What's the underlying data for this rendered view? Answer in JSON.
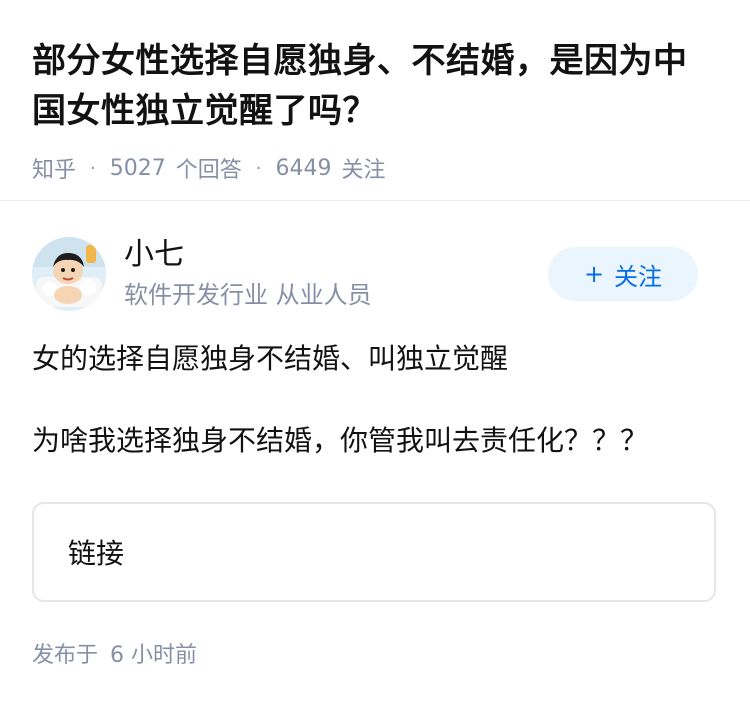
{
  "question": {
    "title": "部分女性选择自愿独身、不结婚，是因为中国女性独立觉醒了吗？",
    "source": "知乎",
    "answer_count": "5027",
    "answer_label": "个回答",
    "follow_count": "6449",
    "follow_label": "关注"
  },
  "author": {
    "name": "小七",
    "description": "软件开发行业 从业人员",
    "follow_button_label": "关注",
    "follow_button_icon": "plus-icon"
  },
  "answer": {
    "paragraphs": [
      "女的选择自愿独身不结婚、叫独立觉醒",
      "为啥我选择独身不结婚，你管我叫去责任化？？？"
    ],
    "link_label": "链接"
  },
  "footer": {
    "published_label": "发布于",
    "published_time": "6 小时前"
  },
  "colors": {
    "accent": "#056de8",
    "accent_bg": "#ebf5fd",
    "meta_text": "#8590a6",
    "title_text": "#121212"
  }
}
